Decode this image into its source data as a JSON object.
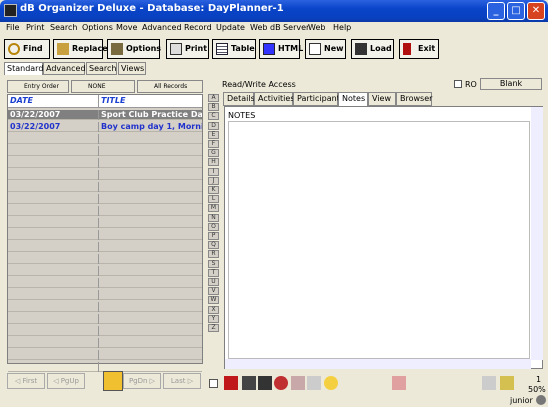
{
  "window": {
    "title": "dB Organizer Deluxe - Database: DayPlanner-1"
  },
  "menu": [
    "File",
    "Print",
    "Search",
    "Options",
    "Move",
    "Advanced",
    "Record",
    "Update",
    "Web dB Server",
    "Web",
    "Help"
  ],
  "toolbar": {
    "find": "Find",
    "replace": "Replace",
    "options": "Options",
    "print": "Print",
    "table": "Table",
    "html": "HTML",
    "new": "New",
    "load": "Load",
    "exit": "Exit"
  },
  "mode_tabs": [
    "Standard",
    "Advanced",
    "Search",
    "Views"
  ],
  "sort_bar": {
    "order": "Entry Order",
    "filter": "NONE",
    "records": "All Records"
  },
  "grid": {
    "headers": [
      "DATE",
      "TITLE"
    ],
    "rows": [
      {
        "date": "03/22/2007",
        "title": "Sport Club Practice Da",
        "selected": true
      },
      {
        "date": "03/22/2007",
        "title": "Boy camp day 1, Morni",
        "selected": false
      }
    ]
  },
  "nav": {
    "first": "First",
    "pgup": "PgUp",
    "pgdn": "PgDn",
    "last": "Last"
  },
  "alpha": [
    "A",
    "B",
    "C",
    "D",
    "E",
    "F",
    "G",
    "H",
    "I",
    "J",
    "K",
    "L",
    "M",
    "N",
    "O",
    "P",
    "Q",
    "R",
    "S",
    "T",
    "U",
    "V",
    "W",
    "X",
    "Y",
    "Z"
  ],
  "record": {
    "access": "Read/Write Access",
    "ro": "RO",
    "blank": "Blank"
  },
  "detail_tabs": [
    "Details",
    "Activities",
    "Participants",
    "Notes",
    "View",
    "Browser"
  ],
  "active_tab": "Notes",
  "notes_label": "NOTES",
  "status": {
    "counter": "1",
    "zoom": "50%",
    "user": "junior"
  },
  "colors": {
    "title_bar": "#0a44c8",
    "header_text": "#1a3ed0",
    "selected_row": "#808080",
    "link_row": "#2233cc"
  }
}
